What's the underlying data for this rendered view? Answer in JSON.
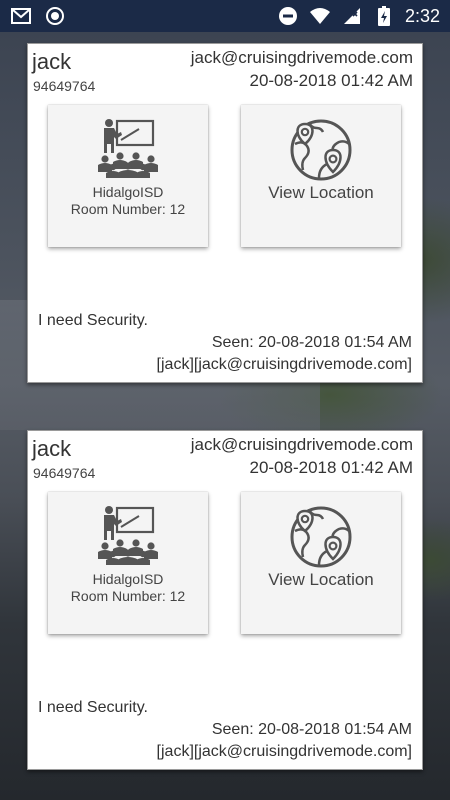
{
  "status_bar": {
    "time": "2:32",
    "icons": [
      "gmail-icon",
      "record-icon",
      "do-not-disturb-icon",
      "wifi-icon",
      "signal-icon",
      "battery-icon"
    ]
  },
  "cards": [
    {
      "sender": {
        "name": "jack",
        "phone": "94649764",
        "email": "jack@cruisingdrivemode.com"
      },
      "sent_time": "20-08-2018 01:42 AM",
      "school_tile": {
        "icon": "classroom-icon",
        "school_name": "HidalgoISD",
        "room_label": "Room Number:",
        "room_number": "12"
      },
      "location_tile": {
        "icon": "globe-location-icon",
        "label": "View Location"
      },
      "message": "I need Security.",
      "seen": {
        "label": "Seen:",
        "time": "20-08-2018 01:54 AM",
        "by_name": "jack",
        "by_email": "jack@cruisingdrivemode.com"
      }
    },
    {
      "sender": {
        "name": "jack",
        "phone": "94649764",
        "email": "jack@cruisingdrivemode.com"
      },
      "sent_time": "20-08-2018 01:42 AM",
      "school_tile": {
        "icon": "classroom-icon",
        "school_name": "HidalgoISD",
        "room_label": "Room Number:",
        "room_number": "12"
      },
      "location_tile": {
        "icon": "globe-location-icon",
        "label": "View Location"
      },
      "message": "I need Security.",
      "seen": {
        "label": "Seen:",
        "time": "20-08-2018 01:54 AM",
        "by_name": "jack",
        "by_email": "jack@cruisingdrivemode.com"
      }
    }
  ],
  "colors": {
    "status_bar": "#1b2a47",
    "card_bg": "#ffffff",
    "tile_bg": "#f4f4f4",
    "text": "#333333",
    "icon": "#555555"
  }
}
